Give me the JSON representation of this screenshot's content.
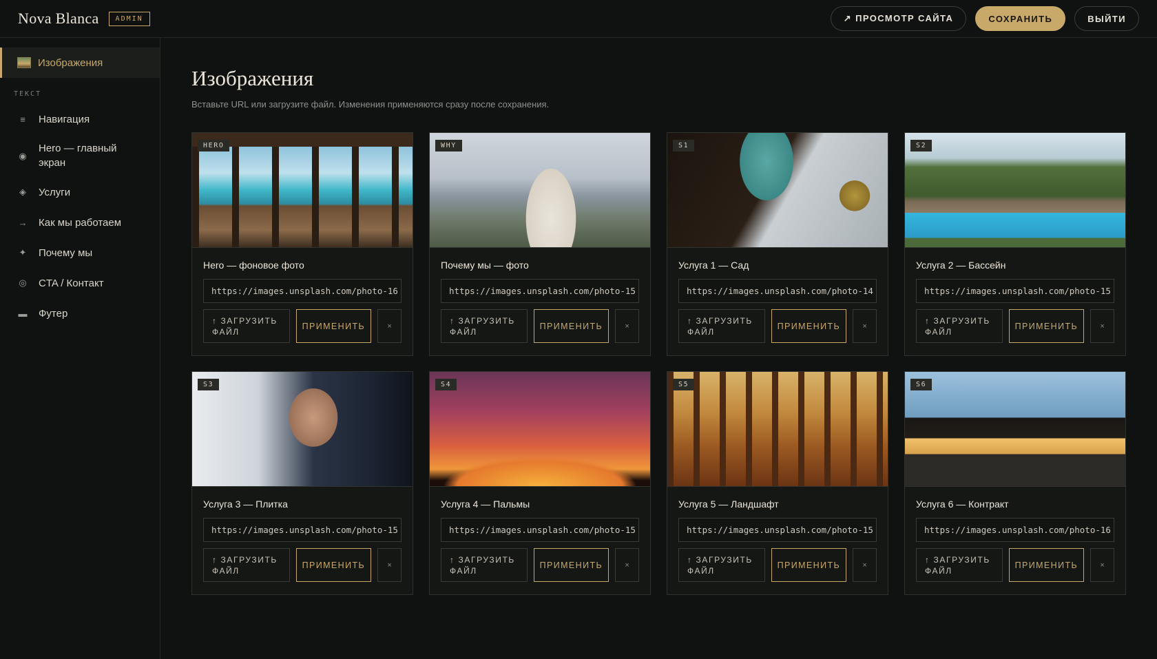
{
  "header": {
    "brand": "Nova Blanca",
    "badge": "ADMIN",
    "view_site": "↗ ПРОСМОТР САЙТА",
    "save": "СОХРАНИТЬ",
    "logout": "ВЫЙТИ"
  },
  "sidebar": {
    "active": "Изображения",
    "section_label": "ТЕКСТ",
    "items": [
      {
        "icon": "≡",
        "label": "Навигация"
      },
      {
        "icon": "◉",
        "label": "Hero — главный экран"
      },
      {
        "icon": "◈",
        "label": "Услуги"
      },
      {
        "icon": "→",
        "label": "Как мы работаем"
      },
      {
        "icon": "✦",
        "label": "Почему мы"
      },
      {
        "icon": "◎",
        "label": "CTA / Контакт"
      },
      {
        "icon": "▬",
        "label": "Футер"
      }
    ]
  },
  "main": {
    "title": "Изображения",
    "subtitle": "Вставьте URL или загрузите файл. Изменения применяются сразу после сохранения.",
    "upload_label": "↑ ЗАГРУЗИТЬ ФАЙЛ",
    "apply_label": "ПРИМЕНИТЬ",
    "clear_label": "×",
    "cards": [
      {
        "tag": "HERO",
        "title": "Hero — фоновое фото",
        "url": "https://images.unsplash.com/photo-16"
      },
      {
        "tag": "WHY",
        "title": "Почему мы — фото",
        "url": "https://images.unsplash.com/photo-15"
      },
      {
        "tag": "S1",
        "title": "Услуга 1 — Сад",
        "url": "https://images.unsplash.com/photo-14"
      },
      {
        "tag": "S2",
        "title": "Услуга 2 — Бассейн",
        "url": "https://images.unsplash.com/photo-15"
      },
      {
        "tag": "S3",
        "title": "Услуга 3 — Плитка",
        "url": "https://images.unsplash.com/photo-15"
      },
      {
        "tag": "S4",
        "title": "Услуга 4 — Пальмы",
        "url": "https://images.unsplash.com/photo-15"
      },
      {
        "tag": "S5",
        "title": "Услуга 5 — Ландшафт",
        "url": "https://images.unsplash.com/photo-15"
      },
      {
        "tag": "S6",
        "title": "Услуга 6 — Контракт",
        "url": "https://images.unsplash.com/photo-16"
      }
    ]
  },
  "colors": {
    "accent": "#c9a96a",
    "background": "#0f1210",
    "card": "#141714"
  }
}
